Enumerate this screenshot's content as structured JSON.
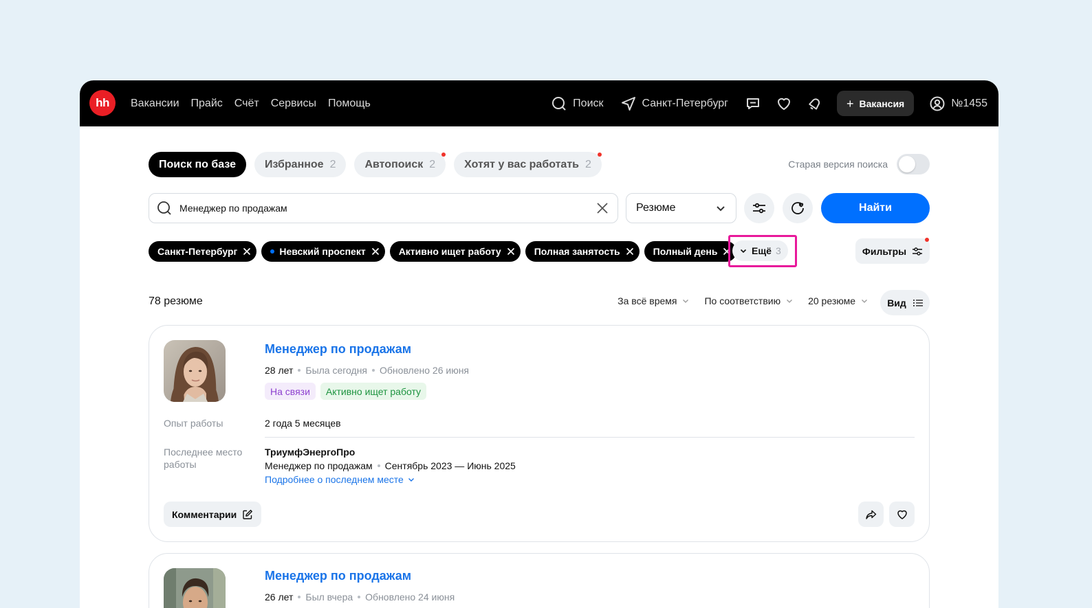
{
  "topbar": {
    "logo": "hh",
    "nav": [
      "Вакансии",
      "Прайс",
      "Счёт",
      "Сервисы",
      "Помощь"
    ],
    "search_label": "Поиск",
    "city": "Санкт-Петербург",
    "vacancy_button": "Вакансия",
    "account": "№1455"
  },
  "tabs": [
    {
      "label": "Поиск по базе",
      "count": ""
    },
    {
      "label": "Избранное",
      "count": "2"
    },
    {
      "label": "Автопоиск",
      "count": "2"
    },
    {
      "label": "Хотят у вас работать",
      "count": "2"
    }
  ],
  "old_version": {
    "label": "Старая версия поиска",
    "enabled": false
  },
  "search": {
    "value": "Менеджер по продажам",
    "type_select": "Резюме",
    "find_button": "Найти"
  },
  "chips": [
    "Санкт-Петербург",
    "Невский проспект",
    "Активно ищет работу",
    "Полная занятость",
    "Полный день"
  ],
  "more_chip": {
    "label": "Ещё",
    "count": "3"
  },
  "filters_button": "Фильтры",
  "results": {
    "count_label": "78 резюме",
    "sort_period": "За всё время",
    "sort_order": "По соответствию",
    "per_page": "20 резюме",
    "view_button": "Вид"
  },
  "cards": [
    {
      "title": "Менеджер по продажам",
      "age": "28 лет",
      "seen": "Была сегодня",
      "updated": "Обновлено 26 июня",
      "badge_contact": "На связи",
      "badge_status": "Активно ищет работу",
      "experience_label": "Опыт работы",
      "experience_value": "2 года 5 месяцев",
      "last_place_label": "Последнее место работы",
      "company": "ТриумфЭнергоПро",
      "position": "Менеджер по продажам",
      "period": "Сентябрь 2023 — Июнь 2025",
      "more_link": "Подробнее о последнем месте",
      "comments_button": "Комментарии"
    },
    {
      "title": "Менеджер по продажам",
      "age": "26 лет",
      "seen": "Был вчера",
      "updated": "Обновлено 24 июня"
    }
  ],
  "colors": {
    "accent": "#0070ff",
    "logo": "#ea1f25",
    "highlight": "#e8199b",
    "link": "#1a74e8"
  }
}
